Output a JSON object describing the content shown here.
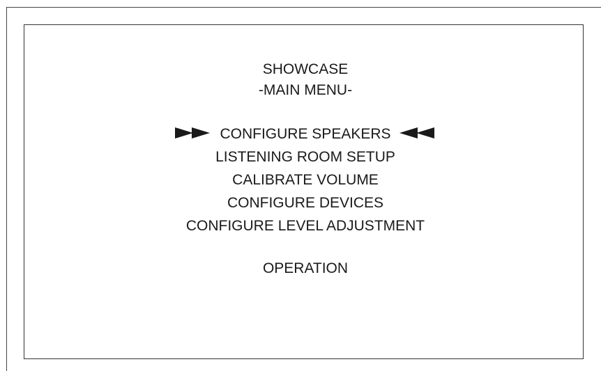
{
  "menu": {
    "title": "SHOWCASE",
    "subtitle": "-MAIN MENU-",
    "items": [
      {
        "label": "CONFIGURE SPEAKERS",
        "selected": true
      },
      {
        "label": "LISTENING ROOM SETUP",
        "selected": false
      },
      {
        "label": "CALIBRATE VOLUME",
        "selected": false
      },
      {
        "label": "CONFIGURE DEVICES",
        "selected": false
      },
      {
        "label": "CONFIGURE LEVEL ADJUSTMENT",
        "selected": false
      },
      {
        "label": "OPERATION",
        "selected": false
      }
    ],
    "cursor_icons": {
      "left": "double-arrow-right-icon",
      "right": "double-arrow-left-icon"
    }
  },
  "colors": {
    "text": "#1a1a1a",
    "background": "#ffffff",
    "border": "#333333"
  }
}
